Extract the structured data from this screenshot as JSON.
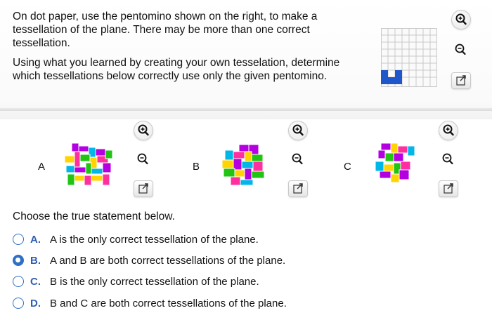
{
  "intro": {
    "paragraph1": "On dot paper, use the pentomino shown on the right, to make a tessellation of the plane. There may be more than one correct tessellation.",
    "paragraph2": "Using what you learned by creating your own tesselation, determine which tessellations below correctly use only the given pentomino."
  },
  "tessellations": [
    {
      "label": "A"
    },
    {
      "label": "B"
    },
    {
      "label": "C"
    }
  ],
  "question": "Choose the true statement below.",
  "options": [
    {
      "letter": "A.",
      "text": "A is the only correct tessellation of the plane.",
      "selected": false
    },
    {
      "letter": "B.",
      "text": "A and B are both correct tessellations of the plane.",
      "selected": true
    },
    {
      "letter": "C.",
      "text": "B is the only correct tessellation of the plane.",
      "selected": false
    },
    {
      "letter": "D.",
      "text": "B and C are both correct tessellations of the plane.",
      "selected": false
    }
  ],
  "colors": {
    "accent": "#2f6fc6",
    "pentomino": "#1f56c9",
    "tile_colors": [
      "#ffd400",
      "#b400e0",
      "#00b7e8",
      "#ff2fa0",
      "#22c414"
    ]
  },
  "icons": [
    "zoom-in-icon",
    "zoom-out-icon",
    "external-link-icon"
  ]
}
